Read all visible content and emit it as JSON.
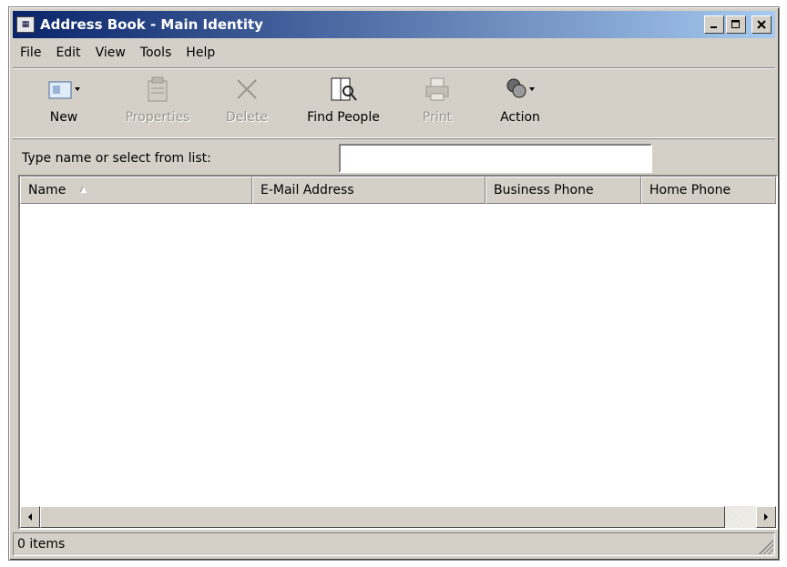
{
  "window": {
    "title": "Address Book - Main Identity",
    "icon": "address-book-icon"
  },
  "menu": [
    "File",
    "Edit",
    "View",
    "Tools",
    "Help"
  ],
  "toolbar": {
    "new": {
      "label": "New",
      "icon": "new-contact-icon",
      "enabled": true
    },
    "properties": {
      "label": "Properties",
      "icon": "properties-icon",
      "enabled": false
    },
    "delete": {
      "label": "Delete",
      "icon": "delete-icon",
      "enabled": false
    },
    "find_people": {
      "label": "Find People",
      "icon": "find-people-icon",
      "enabled": true
    },
    "print": {
      "label": "Print",
      "icon": "print-icon",
      "enabled": false
    },
    "action": {
      "label": "Action",
      "icon": "action-icon",
      "enabled": true
    }
  },
  "search": {
    "label": "Type name or select from list:",
    "value": ""
  },
  "columns": [
    "Name",
    "E-Mail Address",
    "Business Phone",
    "Home Phone"
  ],
  "rows": [],
  "status": {
    "text": "0 items"
  },
  "colors": {
    "titlebar_start": "#0a246a",
    "titlebar_end": "#a6caf0",
    "face": "#d4d0c8"
  }
}
